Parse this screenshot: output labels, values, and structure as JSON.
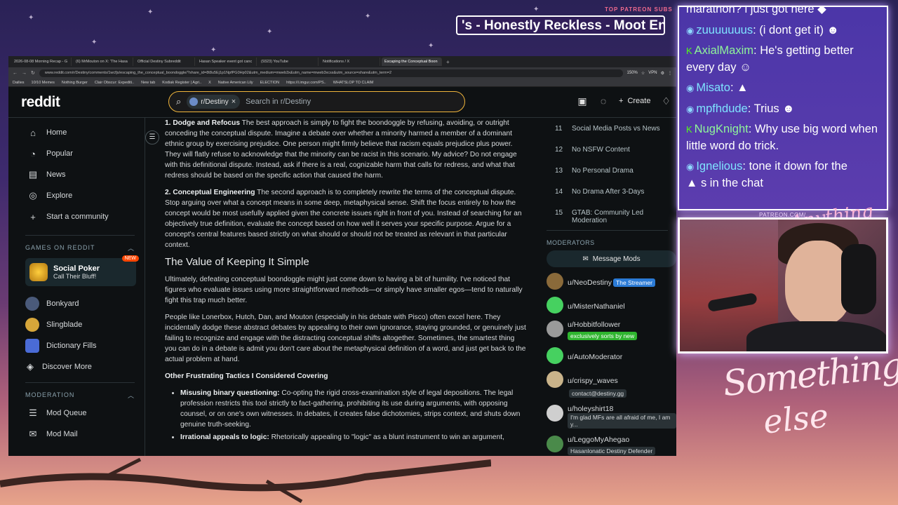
{
  "overlay": {
    "patreon_label": "TOP PATREON SUBS",
    "ticker_text": "'s - Honestly Reckless - Moot Enj",
    "patreon_url": "PATREON.COM/",
    "signature_small": "Anything else?",
    "signature_big_line1": "Something",
    "signature_big_line2": "else"
  },
  "browser": {
    "tabs": [
      "2026-08-08 Morning Recap - G",
      "(6) MrMouton on X: 'The Hasa",
      "Official Destiny Subreddit",
      "Hasan Speaker event got canc",
      "(9323) YouTube",
      "Notifications / X",
      "Escaping the Conceptual Boon"
    ],
    "url": "www.reddit.com/r/Destiny/comments/1wcfjs/escaping_the_conceptual_boondoggle/?share_id=8t8u5Ej1p1NpfPG0Hp02&utm_medium=mweb3x&utm_name=mweb3xcss&utm_source=share&utm_term=2",
    "zoom": "150%",
    "vpn": "VPN",
    "bookmarks": [
      "Dailies",
      "10/10 Memes",
      "Nothing Burger",
      "Clair Obscur: Expediti..",
      "New tab",
      "Kodiak Register | Agri..",
      "X",
      "Native American Lily",
      "ELECTION",
      "https://i.imgur.com/PS..",
      "WHATSLOP TO CLAIM"
    ]
  },
  "header": {
    "logo": "reddit",
    "search_chip": "r/Destiny",
    "search_placeholder": "Search in r/Destiny",
    "create_label": "Create"
  },
  "left_sidebar": {
    "nav": [
      {
        "label": "Home",
        "icon": "home-icon"
      },
      {
        "label": "Popular",
        "icon": "popular-icon"
      },
      {
        "label": "News",
        "icon": "news-icon"
      },
      {
        "label": "Explore",
        "icon": "explore-icon"
      },
      {
        "label": "Start a community",
        "icon": "plus-icon"
      }
    ],
    "games_header": "GAMES ON REDDIT",
    "featured_game": {
      "title": "Social Poker",
      "subtitle": "Call Their Bluff!",
      "badge": "NEW"
    },
    "games": [
      "Bonkyard",
      "Slingblade",
      "Dictionary Fills",
      "Discover More"
    ],
    "moderation_header": "MODERATION",
    "mod_items": [
      "Mod Queue",
      "Mod Mail"
    ]
  },
  "article": {
    "p1_bold": "1. Dodge and Refocus",
    "p1": " The best approach is simply to fight the boondoggle by refusing, avoiding, or outright conceding the conceptual dispute. Imagine a debate over whether a minority harmed a member of a dominant ethnic group by exercising prejudice. One person might firmly believe that racism equals prejudice plus power. They will flatly refuse to acknowledge that the minority can be racist in this scenario. My advice? Do not engage with this definitional dispute. Instead, ask if there is a real, cognizable harm that calls for redress, and what that redress should be based on the specific action that caused the harm.",
    "p2_bold": "2. Conceptual Engineering",
    "p2": " The second approach is to completely rewrite the terms of the conceptual dispute. Stop arguing over what a concept means in some deep, metaphysical sense. Shift the focus entirely to how the concept would be most usefully applied given the concrete issues right in front of you. Instead of searching for an objectively true definition, evaluate the concept based on how well it serves your specific purpose. Argue for a concept's central features based strictly on what should or should not be treated as relevant in that particular context.",
    "h2": "The Value of Keeping It Simple",
    "p3": "Ultimately, defeating conceptual boondoggle might just come down to having a bit of humility. I've noticed that figures who evaluate issues using more straightforward methods—or simply have smaller egos—tend to naturally fight this trap much better.",
    "p4": "People like Lonerbox, Hutch, Dan, and Mouton (especially in his debate with Pisco) often excel here. They incidentally dodge these abstract debates by appealing to their own ignorance, staying grounded, or genuinely just failing to recognize and engage with the distracting conceptual shifts altogether. Sometimes, the smartest thing you can do in a debate is admit you don't care about the metaphysical definition of a word, and just get back to the actual problem at hand.",
    "h3": "Other Frustrating Tactics I Considered Covering",
    "li1_bold": "Misusing binary questioning:",
    "li1": " Co-opting the rigid cross-examination style of legal depositions. The legal profession restricts this tool strictly to fact-gathering, prohibiting its use during arguments, with opposing counsel, or on one's own witnesses. In debates, it creates false dichotomies, strips context, and shuts down genuine truth-seeking.",
    "li2_bold": "Irrational appeals to logic:",
    "li2": " Rhetorically appealing to \"logic\" as a blunt instrument to win an argument,"
  },
  "right_sidebar": {
    "rules": [
      {
        "n": "11",
        "text": "Social Media Posts vs News"
      },
      {
        "n": "12",
        "text": "No NSFW Content"
      },
      {
        "n": "13",
        "text": "No Personal Drama"
      },
      {
        "n": "14",
        "text": "No Drama After 3-Days"
      },
      {
        "n": "15",
        "text": "GTAB: Community Led Moderation"
      }
    ],
    "moderators_header": "MODERATORS",
    "message_mods": "Message Mods",
    "mods": [
      {
        "name": "u/NeoDestiny",
        "flair": "The Streamer",
        "flair_bg": "#2b7bd6",
        "av": "#8a6a3a"
      },
      {
        "name": "u/MisterNathaniel",
        "flair": "",
        "flair_bg": "",
        "av": "#46d160"
      },
      {
        "name": "u/Hobbitfollower",
        "flair": "exclusively sorts by new",
        "flair_bg": "#2fb52f",
        "av": "#9a9a9a"
      },
      {
        "name": "u/AutoModerator",
        "flair": "",
        "flair_bg": "",
        "av": "#46d160"
      },
      {
        "name": "u/crispy_waves",
        "flair": "contact@destiny.gg",
        "flair_bg": "#2a3236",
        "av": "#c9b38a"
      },
      {
        "name": "u/holeyshirt18",
        "flair": "I'm glad MFs are all afraid of me, I am y...",
        "flair_bg": "#2a3236",
        "av": "#cfcfcf"
      },
      {
        "name": "u/LeggoMyAhegao",
        "flair": "Hasanlonatic Destiny Defender",
        "flair_bg": "#2a3236",
        "av": "#4a8a4a"
      }
    ]
  },
  "chat": {
    "messages": [
      {
        "user": "",
        "text": "marathon? i just got here",
        "badge": ""
      },
      {
        "user": "zuuuuuuus",
        "text": ": (i dont get it)",
        "badge": "circle"
      },
      {
        "user": "AxialMaxim",
        "text": ": He's getting better every day",
        "badge": "kick"
      },
      {
        "user": "Misato",
        "text": ":",
        "badge": "circle"
      },
      {
        "user": "mpfhdude",
        "text": ": Trius",
        "badge": "circle"
      },
      {
        "user": "NugKnight",
        "text": ": Why use big word when little word do trick.",
        "badge": "kick"
      },
      {
        "user": "Ignelious",
        "text": ": tone it down for the",
        "badge": "circle"
      },
      {
        "user": "",
        "text": "s in the chat",
        "badge": ""
      }
    ]
  }
}
